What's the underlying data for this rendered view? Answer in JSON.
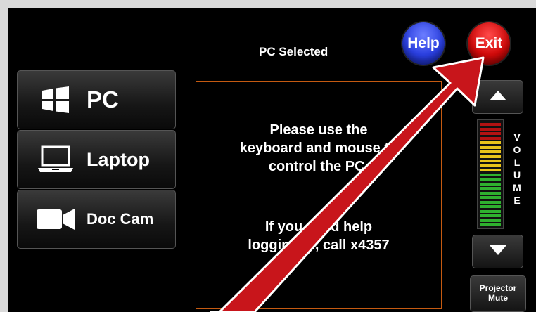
{
  "header": {
    "status": "PC Selected"
  },
  "buttons": {
    "help": "Help",
    "exit": "Exit"
  },
  "sources": [
    {
      "label": "PC",
      "icon": "windows-logo-icon"
    },
    {
      "label": "Laptop",
      "icon": "laptop-icon"
    },
    {
      "label": "Doc Cam",
      "icon": "video-camera-icon"
    }
  ],
  "message": {
    "line1": "Please use the\nkeyboard and mouse to\ncontrol the PC.",
    "line2": "If you need help\nlogging in, call x4357"
  },
  "volume": {
    "label": "VOLUME"
  },
  "projector": {
    "mute_label": "Projector\nMute"
  },
  "colors": {
    "help": "#2a3fe0",
    "exit": "#d10a0a",
    "accent_border": "#c55a11",
    "arrow": "#c8151b"
  }
}
